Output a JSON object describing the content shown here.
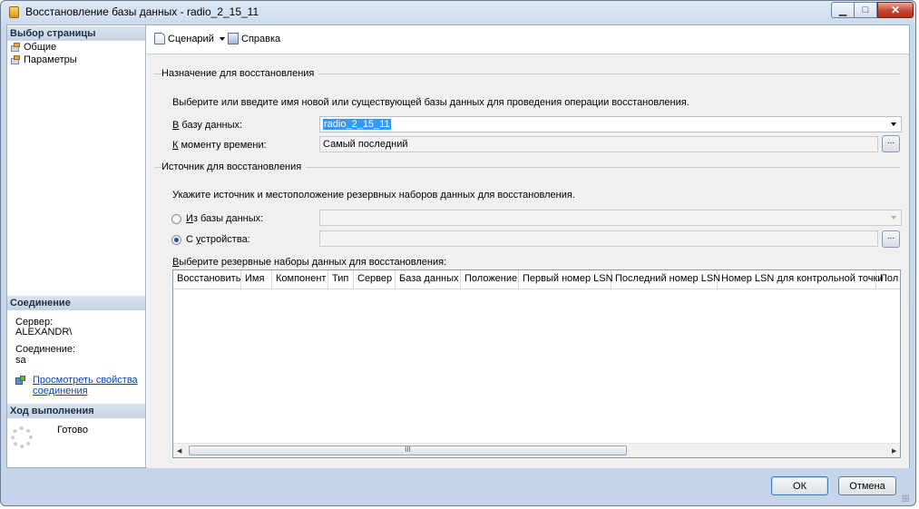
{
  "window": {
    "title": "Восстановление базы данных - radio_2_15_11",
    "minimize_symbol": "▁",
    "maximize_symbol": "□",
    "close_symbol": "✕"
  },
  "left_pane": {
    "select_page_header": "Выбор страницы",
    "pages": [
      "Общие",
      "Параметры"
    ],
    "connection_header": "Соединение",
    "server_label": "Сервер:",
    "server_value": "ALEXANDR\\",
    "connection_label": "Соединение:",
    "connection_value": "sa",
    "view_props_link_line1": "Просмотреть свойства",
    "view_props_link_line2": "соединения",
    "progress_header": "Ход выполнения",
    "progress_status": "Готово"
  },
  "toolbar": {
    "script_label": "Сценарий",
    "help_label": "Справка"
  },
  "destination": {
    "group_title": "Назначение для восстановления",
    "instruction": "Выберите или введите имя новой или существующей базы данных для проведения операции восстановления.",
    "to_db_label_u": "В",
    "to_db_label_rest": " базу данных:",
    "to_db_value": "radio_2_15_11",
    "point_in_time_label_u": "К",
    "point_in_time_label_rest": " моменту времени:",
    "point_in_time_value": "Самый последний",
    "browse_label": "..."
  },
  "source": {
    "group_title": "Источник для восстановления",
    "instruction": "Укажите источник и местоположение резервных наборов данных для восстановления.",
    "from_db_label_u": "И",
    "from_db_label_rest": "з базы данных:",
    "from_device_label_pre": "С ",
    "from_device_label_u": "у",
    "from_device_label_rest": "стройства:",
    "selected_option": "from_device",
    "browse_label": "...",
    "backup_sets_label_u": "В",
    "backup_sets_label_rest": "ыберите резервные наборы данных для восстановления:"
  },
  "grid": {
    "columns": [
      "Восстановить",
      "Имя",
      "Компонент",
      "Тип",
      "Сервер",
      "База данных",
      "Положение",
      "Первый номер LSN",
      "Последний номер LSN",
      "Номер LSN для контрольной точки",
      "Пол"
    ],
    "rows": [],
    "scroll_thumb_symbol": "III",
    "scroll_left": "◀",
    "scroll_right": "▶"
  },
  "buttons": {
    "ok": "ОК",
    "cancel": "Отмена"
  }
}
